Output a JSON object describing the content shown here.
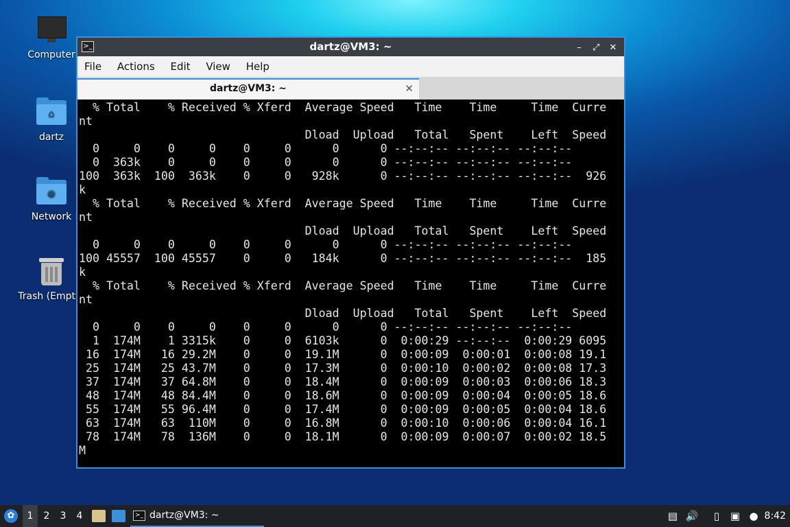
{
  "desktop": {
    "icons": [
      {
        "label": "Computer"
      },
      {
        "label": "dartz"
      },
      {
        "label": "Network"
      },
      {
        "label": "Trash (Empty)"
      }
    ]
  },
  "window": {
    "title": "dartz@VM3: ~",
    "controls": {
      "minimize": "–",
      "maximize": "⤢",
      "close": "✕"
    },
    "menu": [
      "File",
      "Actions",
      "Edit",
      "View",
      "Help"
    ],
    "tab": {
      "label": "dartz@VM3: ~",
      "close": "✕"
    },
    "terminal_lines": [
      "  % Total    % Received % Xferd  Average Speed   Time    Time     Time  Curre",
      "nt",
      "                                 Dload  Upload   Total   Spent    Left  Speed",
      "  0     0    0     0    0     0      0      0 --:--:-- --:--:-- --:--:--",
      "  0  363k    0     0    0     0      0      0 --:--:-- --:--:-- --:--:--",
      "100  363k  100  363k    0     0   928k      0 --:--:-- --:--:-- --:--:--  926",
      "k",
      "  % Total    % Received % Xferd  Average Speed   Time    Time     Time  Curre",
      "nt",
      "                                 Dload  Upload   Total   Spent    Left  Speed",
      "  0     0    0     0    0     0      0      0 --:--:-- --:--:-- --:--:--",
      "100 45557  100 45557    0     0   184k      0 --:--:-- --:--:-- --:--:--  185",
      "k",
      "  % Total    % Received % Xferd  Average Speed   Time    Time     Time  Curre",
      "nt",
      "                                 Dload  Upload   Total   Spent    Left  Speed",
      "  0     0    0     0    0     0      0      0 --:--:-- --:--:-- --:--:--",
      "  1  174M    1 3315k    0     0  6103k      0  0:00:29 --:--:--  0:00:29 6095",
      " 16  174M   16 29.2M    0     0  19.1M      0  0:00:09  0:00:01  0:00:08 19.1",
      " 25  174M   25 43.7M    0     0  17.3M      0  0:00:10  0:00:02  0:00:08 17.3",
      " 37  174M   37 64.8M    0     0  18.4M      0  0:00:09  0:00:03  0:00:06 18.3",
      " 48  174M   48 84.4M    0     0  18.6M      0  0:00:09  0:00:04  0:00:05 18.6",
      " 55  174M   55 96.4M    0     0  17.4M      0  0:00:09  0:00:05  0:00:04 18.6",
      " 63  174M   63  110M    0     0  16.8M      0  0:00:10  0:00:06  0:00:04 16.1",
      " 78  174M   78  136M    0     0  18.1M      0  0:00:09  0:00:07  0:00:02 18.5",
      "M"
    ]
  },
  "taskbar": {
    "workspaces": [
      "1",
      "2",
      "3",
      "4"
    ],
    "active_workspace": "1",
    "task_label": "dartz@VM3: ~",
    "clock": "8:42"
  },
  "colors": {
    "accent": "#3e8fd9",
    "terminal_bg": "#000000",
    "terminal_fg": "#e6e6e6"
  }
}
